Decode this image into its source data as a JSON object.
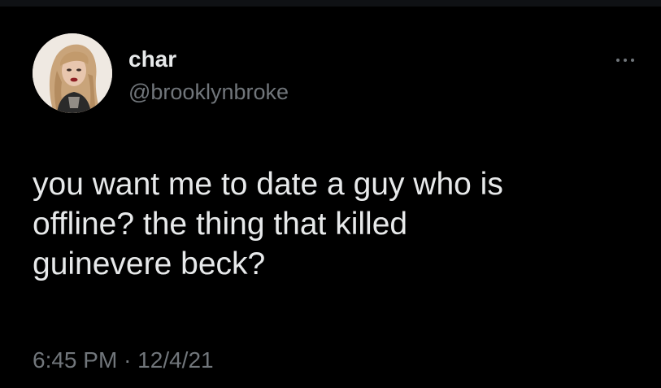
{
  "tweet": {
    "author": {
      "display_name": "char",
      "handle": "@brooklynbroke",
      "avatar_icon": "profile-photo"
    },
    "more_icon": "more-horizontal-icon",
    "text_lines": [
      "you want me to date a guy who is",
      "offline? the thing that killed",
      "guinevere beck?"
    ],
    "time": "6:45 PM",
    "separator": "·",
    "date": "12/4/21"
  },
  "colors": {
    "background": "#000000",
    "primary_text": "#e7e9ea",
    "secondary_text": "#71767b"
  }
}
